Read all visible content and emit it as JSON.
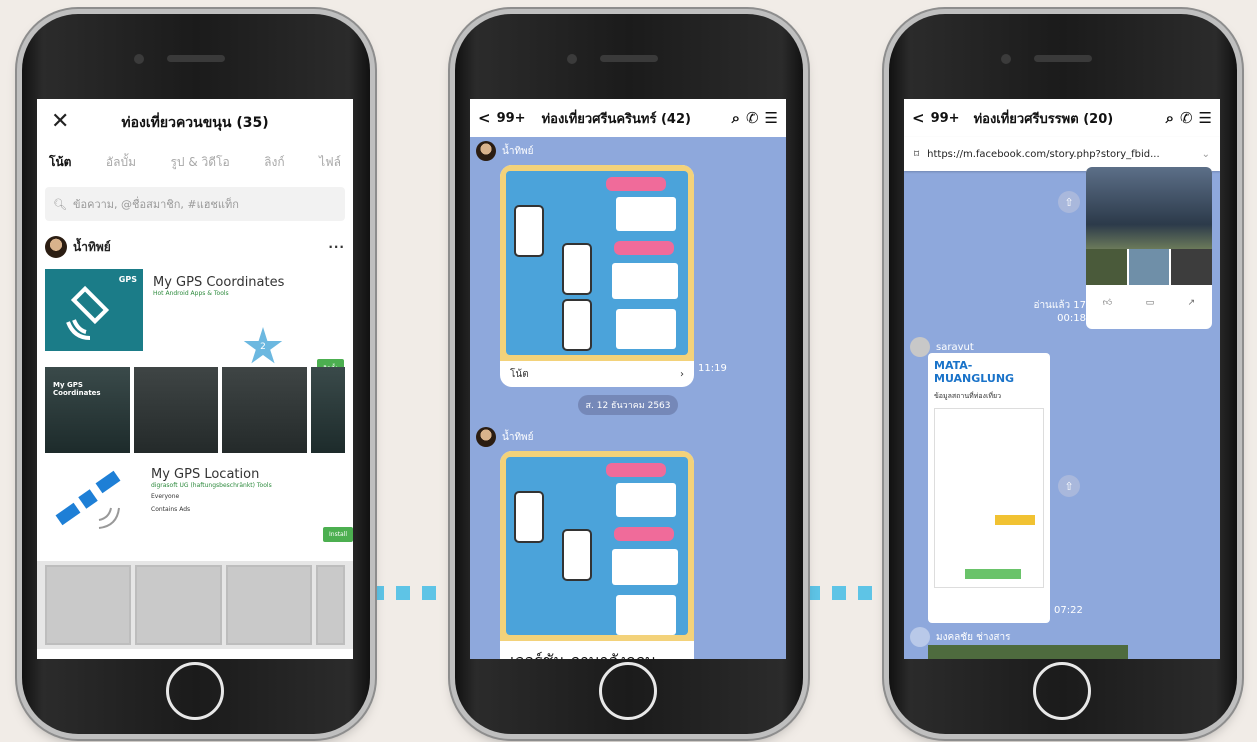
{
  "phone1": {
    "title": "ท่องเที่ยวควนขนุน (35)",
    "tabs": [
      "โน้ต",
      "อัลบั้ม",
      "รูป & วิดีโอ",
      "ลิงก์",
      "ไฟล์"
    ],
    "search_placeholder": "ข้อความ, @ชื่อสมาชิก, #แฮชแท็ก",
    "poster": "น้ำทิพย์",
    "apps": [
      {
        "name": "My GPS Coordinates",
        "sub": "Hot Android Apps & Tools",
        "badge": "2",
        "install": "ติดตั้ง"
      },
      {
        "name": "My GPS Location",
        "sub": "digrasoft UG (haftungsbeschränkt)   Tools",
        "rating_label": "Everyone",
        "ads": "Contains Ads",
        "install": "Install"
      }
    ],
    "screenshot_label": "My GPS Coordinates"
  },
  "phone2": {
    "back": "99+",
    "title": "ท่องเที่ยวศรีนครินทร์ (42)",
    "sender": "น้ำทิพย์",
    "note_label": "โน้ต",
    "time1": "11:19",
    "date": "ส. 12 ธันวาคม 2563",
    "english_label": "เวอร์ชัน ภาษาอังกฤษ"
  },
  "phone3": {
    "back": "99+",
    "title": "ท่องเที่ยวศรีบรรพต (20)",
    "url": "https://m.facebook.com/story.php?story_fbid...",
    "read": "อ่านแล้ว 17",
    "read_time": "00:18",
    "sender2": "saravut",
    "brand": "MATA-MUANGLUNG",
    "brand_sub": "ข้อมูลสถานที่ท่องเที่ยว",
    "time2": "07:22",
    "sender3": "มงคลชัย ช่างสาร"
  }
}
